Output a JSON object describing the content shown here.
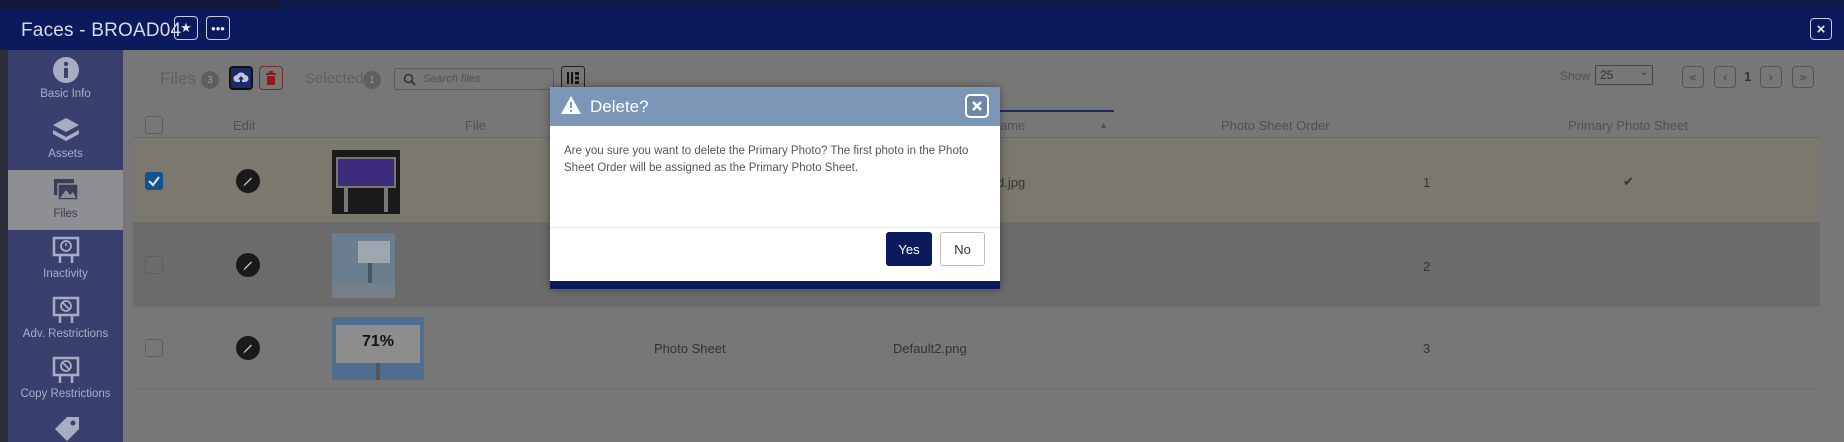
{
  "window": {
    "title": "Faces - BROAD04",
    "star_icon": "star-icon",
    "more_icon": "more-icon",
    "close_icon": "close-icon"
  },
  "sidebar": {
    "items": [
      {
        "label": "Basic Info",
        "icon": "info-icon"
      },
      {
        "label": "Assets",
        "icon": "layers-icon"
      },
      {
        "label": "Files",
        "icon": "images-icon",
        "active": true
      },
      {
        "label": "Inactivity",
        "icon": "billboard-clock-icon"
      },
      {
        "label": "Adv. Restrictions",
        "icon": "billboard-ban-icon"
      },
      {
        "label": "Copy Restrictions",
        "icon": "copy-ban-icon"
      },
      {
        "label": "",
        "icon": "tag-icon"
      }
    ]
  },
  "toolbar": {
    "files_label": "Files",
    "files_count": "3",
    "selected_label": "Selected",
    "selected_count": "1",
    "search_placeholder": "Search files",
    "show_label": "Show",
    "show_value": "25",
    "page_number": "1"
  },
  "table": {
    "headers": {
      "edit": "Edit",
      "file": "File",
      "name": "ame",
      "order": "Photo Sheet Order",
      "primary": "Primary Photo Sheet"
    },
    "rows": [
      {
        "checked": true,
        "name": "d.jpg",
        "type": "",
        "order": "1",
        "primary": "✔"
      },
      {
        "checked": false,
        "name": "",
        "type": "",
        "order": "2",
        "primary": ""
      },
      {
        "checked": false,
        "name": "Default2.png",
        "type": "Photo Sheet",
        "order": "3",
        "primary": "",
        "thumb_text": "71%"
      }
    ]
  },
  "modal": {
    "title": "Delete?",
    "message": "Are you sure you want to delete the Primary Photo? The first photo in the Photo Sheet Order will be assigned as the Primary Photo Sheet.",
    "yes_label": "Yes",
    "no_label": "No"
  },
  "colors": {
    "titlebar": "#0a1a5c",
    "modal_header": "#7b96b6",
    "primary_button": "#0b1a5a"
  }
}
